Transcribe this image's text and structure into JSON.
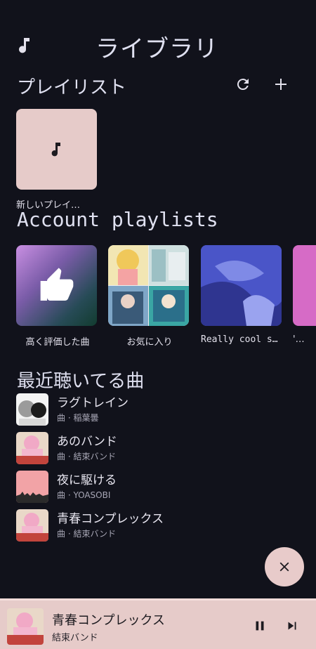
{
  "header": {
    "title": "ライブラリ",
    "icon": "music-note-icon"
  },
  "playlists": {
    "heading": "プレイリスト",
    "refresh_icon": "refresh-icon",
    "add_icon": "plus-icon",
    "new_playlist_label": "新しいプレイ…"
  },
  "account": {
    "heading": "Account playlists",
    "items": [
      {
        "label": "高く評価した曲"
      },
      {
        "label": "お気に入り"
      },
      {
        "label": "Really cool s…"
      },
      {
        "label": "'…"
      }
    ]
  },
  "recent": {
    "heading": "最近聴いてる曲",
    "items": [
      {
        "title": "ラグトレイン",
        "subtitle": "曲 · 稲葉曇"
      },
      {
        "title": "あのバンド",
        "subtitle": "曲 · 結束バンド"
      },
      {
        "title": "夜に駆ける",
        "subtitle": "曲 · YOASOBI"
      },
      {
        "title": "青春コンプレックス",
        "subtitle": "曲 · 結束バンド"
      }
    ]
  },
  "fab": {
    "icon": "close-icon"
  },
  "player": {
    "title": "青春コンプレックス",
    "artist": "結束バンド",
    "pause_icon": "pause-icon",
    "next_icon": "skip-next-icon"
  },
  "colors": {
    "background": "#11121b",
    "accent": "#e6cbc9",
    "text": "#e3e1ec"
  }
}
